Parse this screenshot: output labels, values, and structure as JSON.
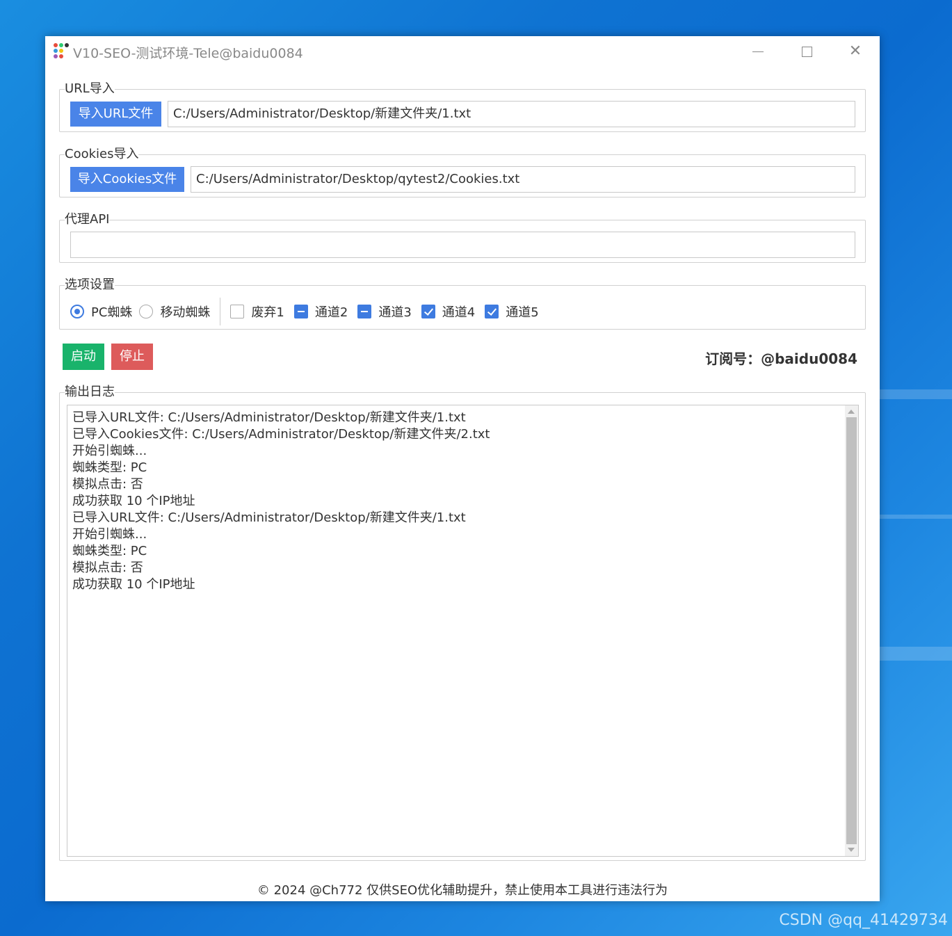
{
  "window": {
    "title": "V10-SEO-测试环境-Tele@baidu0084",
    "controls": {
      "minimize": "minimize-icon",
      "maximize": "maximize-icon",
      "close": "close-icon"
    }
  },
  "url_import": {
    "legend": "URL导入",
    "button_label": "导入URL文件",
    "path_value": "C:/Users/Administrator/Desktop/新建文件夹/1.txt"
  },
  "cookies_import": {
    "legend": "Cookies导入",
    "button_label": "导入Cookies文件",
    "path_value": "C:/Users/Administrator/Desktop/qytest2/Cookies.txt"
  },
  "proxy_api": {
    "legend": "代理API",
    "value": ""
  },
  "options": {
    "legend": "选项设置",
    "radios": [
      {
        "label": "PC蜘蛛",
        "selected": true
      },
      {
        "label": "移动蜘蛛",
        "selected": false
      }
    ],
    "checkboxes": [
      {
        "label": "废弃1",
        "state": "unchecked"
      },
      {
        "label": "通道2",
        "state": "indeterminate"
      },
      {
        "label": "通道3",
        "state": "indeterminate"
      },
      {
        "label": "通道4",
        "state": "checked"
      },
      {
        "label": "通道5",
        "state": "checked"
      }
    ]
  },
  "actions": {
    "start_label": "启动",
    "stop_label": "停止",
    "subscription_prefix": "订阅号：",
    "subscription_value": "@baidu0084"
  },
  "log": {
    "legend": "输出日志",
    "lines": [
      "已导入URL文件: C:/Users/Administrator/Desktop/新建文件夹/1.txt",
      "已导入Cookies文件: C:/Users/Administrator/Desktop/新建文件夹/2.txt",
      "开始引蜘蛛...",
      "蜘蛛类型: PC",
      "模拟点击: 否",
      "成功获取 10 个IP地址",
      "已导入URL文件: C:/Users/Administrator/Desktop/新建文件夹/1.txt",
      "开始引蜘蛛...",
      "蜘蛛类型: PC",
      "模拟点击: 否",
      "成功获取 10 个IP地址"
    ]
  },
  "footer": "© 2024 @Ch772 仅供SEO优化辅助提升，禁止使用本工具进行违法行为",
  "watermark": "CSDN @qq_41429734",
  "colors": {
    "primary_blue": "#4a84e8",
    "start_green": "#19b36b",
    "stop_red": "#dd5b5b",
    "check_blue": "#3e7be0"
  }
}
